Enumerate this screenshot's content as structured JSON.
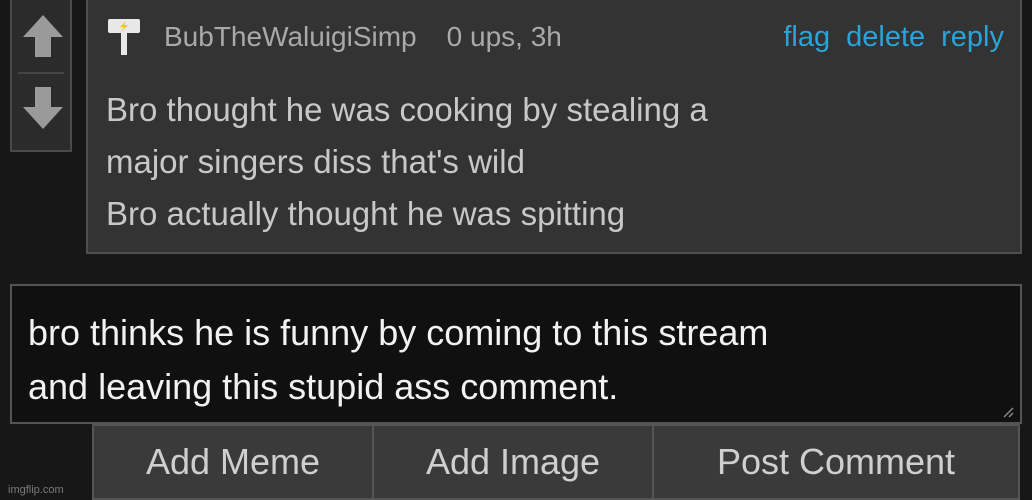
{
  "comment": {
    "username": "BubTheWaluigiSimp",
    "meta": "0 ups, 3h",
    "actions": {
      "flag": "flag",
      "delete": "delete",
      "reply": "reply"
    },
    "lines": [
      "Bro thought he was cooking by stealing a",
      "major singers diss that's wild",
      "Bro actually thought he was spitting"
    ]
  },
  "reply_input": {
    "lines": [
      "bro thinks he is funny by coming to this stream",
      "and leaving this stupid ass comment."
    ]
  },
  "buttons": {
    "add_meme": "Add Meme",
    "add_image": "Add Image",
    "post_comment": "Post Comment"
  },
  "watermark": "imgflip.com",
  "colors": {
    "link": "#2aa4d8",
    "background": "#171717",
    "panel": "#333333",
    "input": "#101010"
  },
  "icons": {
    "upvote": "arrow-up-icon",
    "downvote": "arrow-down-icon",
    "user_avatar": "hammer-icon"
  }
}
